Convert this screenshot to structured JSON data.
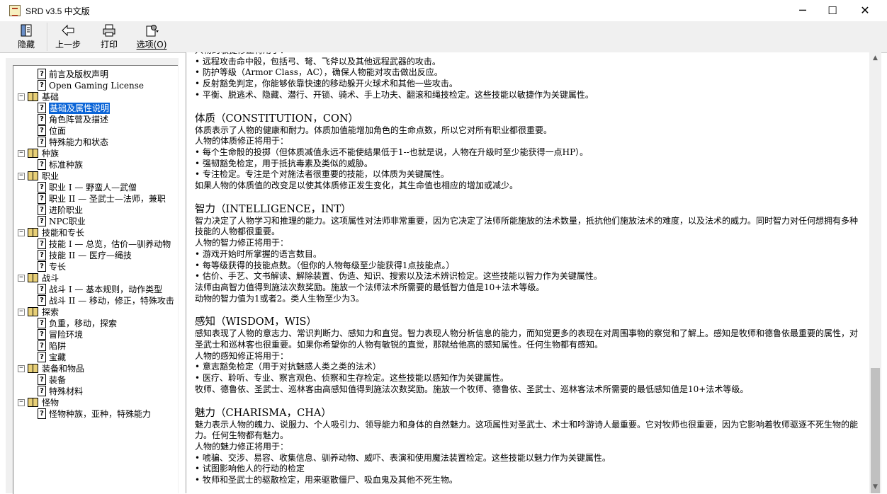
{
  "window": {
    "title": "SRD v3.5 中文版",
    "minimize": "─",
    "maximize": "☐",
    "close": "✕"
  },
  "toolbar": {
    "hide": {
      "label": "隐藏",
      "icon": "hide-pane-icon"
    },
    "back": {
      "label": "上一步",
      "icon": "back-arrow-icon"
    },
    "print": {
      "label": "打印",
      "icon": "printer-icon"
    },
    "options": {
      "label": "选项(O)",
      "icon": "options-icon"
    }
  },
  "tree": [
    {
      "level": 1,
      "type": "page",
      "label": "前言及版权声明"
    },
    {
      "level": 1,
      "type": "page",
      "label": "Open Gaming License"
    },
    {
      "level": 0,
      "type": "book",
      "label": "基础",
      "expander": "−"
    },
    {
      "level": 1,
      "type": "page",
      "label": "基础及属性说明",
      "selected": true
    },
    {
      "level": 1,
      "type": "page",
      "label": "角色阵营及描述"
    },
    {
      "level": 1,
      "type": "page",
      "label": "位面"
    },
    {
      "level": 1,
      "type": "page",
      "label": "特殊能力和状态"
    },
    {
      "level": 0,
      "type": "book",
      "label": "种族",
      "expander": "−"
    },
    {
      "level": 1,
      "type": "page",
      "label": "标准种族"
    },
    {
      "level": 0,
      "type": "book",
      "label": "职业",
      "expander": "−"
    },
    {
      "level": 1,
      "type": "page",
      "label": "职业 I — 野蛮人—武僧"
    },
    {
      "level": 1,
      "type": "page",
      "label": "职业 II — 圣武士—法师，兼职"
    },
    {
      "level": 1,
      "type": "page",
      "label": "进阶职业"
    },
    {
      "level": 1,
      "type": "page",
      "label": "NPC职业"
    },
    {
      "level": 0,
      "type": "book",
      "label": "技能和专长",
      "expander": "−"
    },
    {
      "level": 1,
      "type": "page",
      "label": "技能 I — 总览，估价—驯养动物"
    },
    {
      "level": 1,
      "type": "page",
      "label": "技能 II — 医疗—绳技"
    },
    {
      "level": 1,
      "type": "page",
      "label": "专长"
    },
    {
      "level": 0,
      "type": "book",
      "label": "战斗",
      "expander": "−"
    },
    {
      "level": 1,
      "type": "page",
      "label": "战斗 I — 基本规则，动作类型"
    },
    {
      "level": 1,
      "type": "page",
      "label": "战斗 II — 移动，修正，特殊攻击"
    },
    {
      "level": 0,
      "type": "book",
      "label": "探索",
      "expander": "−"
    },
    {
      "level": 1,
      "type": "page",
      "label": "负重，移动，探索"
    },
    {
      "level": 1,
      "type": "page",
      "label": "冒险环境"
    },
    {
      "level": 1,
      "type": "page",
      "label": "陷阱"
    },
    {
      "level": 1,
      "type": "page",
      "label": "宝藏"
    },
    {
      "level": 0,
      "type": "book",
      "label": "装备和物品",
      "expander": "−"
    },
    {
      "level": 1,
      "type": "page",
      "label": "装备"
    },
    {
      "level": 1,
      "type": "page",
      "label": "特殊材料"
    },
    {
      "level": 0,
      "type": "book",
      "label": "怪物",
      "expander": "−"
    },
    {
      "level": 1,
      "type": "page",
      "label": "怪物种族，亚种，特殊能力"
    }
  ],
  "content": [
    {
      "kind": "p",
      "text": "人物的敏捷修正将用于："
    },
    {
      "kind": "p",
      "text": "• 远程攻击命中骰，包括弓、弩、飞斧以及其他远程武器的攻击。"
    },
    {
      "kind": "p",
      "text": "• 防护等级（Armor Class，AC），确保人物能对攻击做出反应。"
    },
    {
      "kind": "p",
      "text": "• 反射豁免判定，你能够依靠快速的移动躲开火球术和其他一些攻击。"
    },
    {
      "kind": "p",
      "text": "• 平衡、脱逃术、隐藏、潜行、开锁、骑术、手上功夫、翻滚和绳技检定。这些技能以敏捷作为关键属性。"
    },
    {
      "kind": "gap"
    },
    {
      "kind": "h",
      "text": "体质（CONSTITUTION，CON）"
    },
    {
      "kind": "p",
      "text": "体质表示了人物的健康和耐力。体质加值能增加角色的生命点数，所以它对所有职业都很重要。"
    },
    {
      "kind": "p",
      "text": "人物的体质修正将用于："
    },
    {
      "kind": "p",
      "text": "• 每个生命骰的投掷（但体质减值永远不能使结果低于1--也就是说，人物在升级时至少能获得一点HP）。"
    },
    {
      "kind": "p",
      "text": "• 强韧豁免检定，用于抵抗毒素及类似的威胁。"
    },
    {
      "kind": "p",
      "text": "• 专注检定。专注是个对施法者很重要的技能，以体质为关键属性。"
    },
    {
      "kind": "p",
      "text": "如果人物的体质值的改变足以使其体质修正发生变化，其生命值也相应的增加或减少。"
    },
    {
      "kind": "gap"
    },
    {
      "kind": "h",
      "text": "智力（INTELLIGENCE，INT）"
    },
    {
      "kind": "p",
      "text": "智力决定了人物学习和推理的能力。这项属性对法师非常重要，因为它决定了法师所能施放的法术数量，抵抗他们施放法术的难度，以及法术的威力。同时智力对任何想拥有多种技能的人物都很重要。"
    },
    {
      "kind": "p",
      "text": "人物的智力修正将用于："
    },
    {
      "kind": "p",
      "text": "• 游戏开始时所掌握的语言数目。"
    },
    {
      "kind": "p",
      "text": "• 每等级获得的技能点数。（但你的人物每级至少能获得1点技能点。）"
    },
    {
      "kind": "p",
      "text": "• 估价、手艺、文书解读、解除装置、伪造、知识、搜索以及法术辨识检定。这些技能以智力作为关键属性。"
    },
    {
      "kind": "p",
      "text": "法师由高智力值得到施法次数奖励。施放一个法师法术所需要的最低智力值是10+法术等级。"
    },
    {
      "kind": "p",
      "text": "动物的智力值为1或者2。类人生物至少为3。"
    },
    {
      "kind": "gap"
    },
    {
      "kind": "h",
      "text": "感知（WISDOM，WIS）"
    },
    {
      "kind": "p",
      "text": "感知表现了人物的意志力、常识判断力、感知力和直觉。智力表现人物分析信息的能力，而知觉更多的表现在对周围事物的察觉和了解上。感知是牧师和德鲁依最重要的属性，对圣武士和巡林客也很重要。如果你希望你的人物有敏锐的直觉，那就给他高的感知属性。任何生物都有感知。"
    },
    {
      "kind": "p",
      "text": "人物的感知修正将用于："
    },
    {
      "kind": "p",
      "text": "• 意志豁免检定（用于对抗魅惑人类之类的法术）"
    },
    {
      "kind": "p",
      "text": "• 医疗、聆听、专业、察言观色、侦察和生存检定。这些技能以感知作为关键属性。"
    },
    {
      "kind": "p",
      "text": "牧师、德鲁依、圣武士、巡林客由高感知值得到施法次数奖励。施放一个牧师、德鲁依、圣武士、巡林客法术所需要的最低感知值是10+法术等级。"
    },
    {
      "kind": "gap"
    },
    {
      "kind": "h",
      "text": "魅力（CHARISMA，CHA）"
    },
    {
      "kind": "p",
      "text": "魅力表示人物的魄力、说服力、个人吸引力、领导能力和身体的自然魅力。这项属性对圣武士、术士和吟游诗人最重要。它对牧师也很重要，因为它影响着牧师驱逐不死生物的能力。任何生物都有魅力。"
    },
    {
      "kind": "p",
      "text": "人物的魅力修正将用于："
    },
    {
      "kind": "p",
      "text": "• 唬骗、交涉、易容、收集信息、驯养动物、威吓、表演和使用魔法装置检定。这些技能以魅力作为关键属性。"
    },
    {
      "kind": "p",
      "text": "• 试图影响他人的行动的检定"
    },
    {
      "kind": "p",
      "text": "• 牧师和圣武士的驱散检定，用来驱散僵尸、吸血鬼及其他不死生物。"
    }
  ],
  "scrollbar": {
    "up": "▲",
    "down": "▼"
  }
}
